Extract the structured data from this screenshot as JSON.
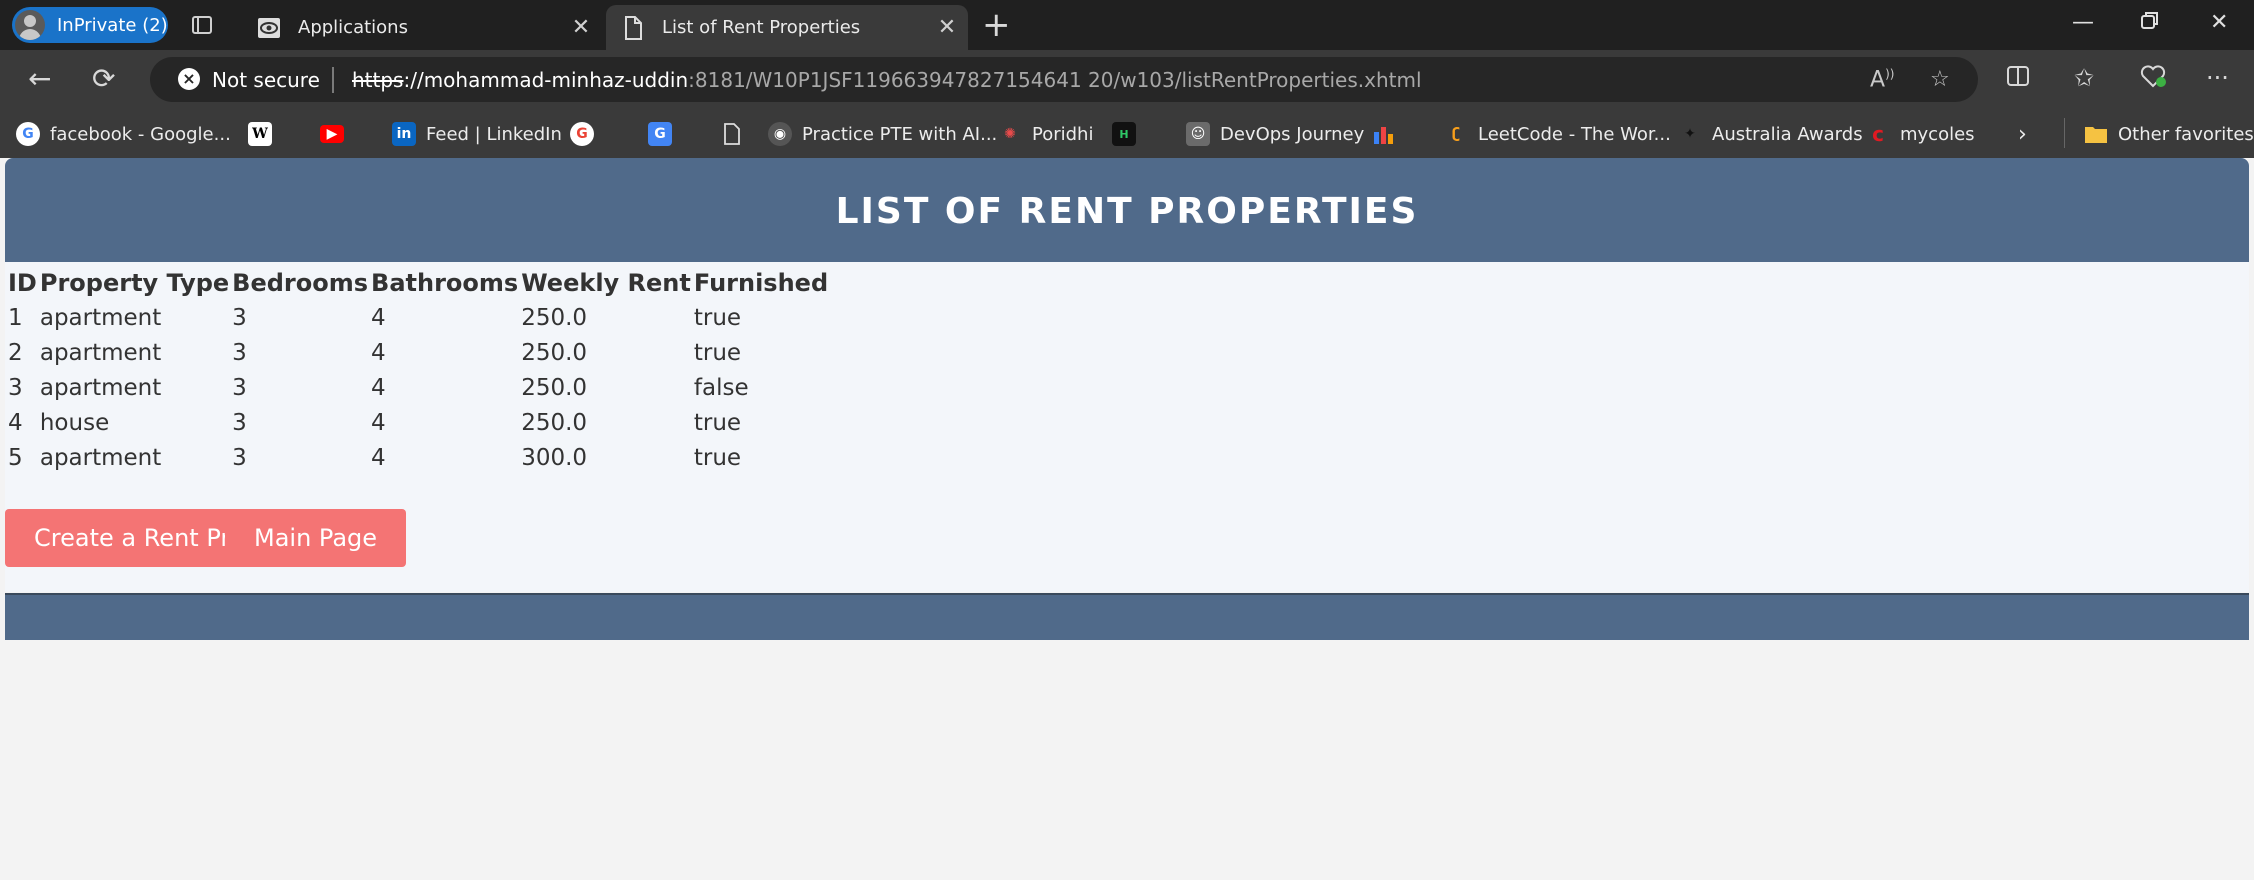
{
  "browser": {
    "profile_label": "InPrivate (2)",
    "tabs": [
      {
        "title": "Applications",
        "active": false
      },
      {
        "title": "List of Rent Properties",
        "active": true
      }
    ],
    "security_label": "Not secure",
    "url": {
      "scheme": "https",
      "sep": "://",
      "host": "mohammad-minhaz-uddin",
      "rest": ":8181/W10P1JSF119663947827154641 20/w103/listRentProperties.xhtml"
    },
    "bookmarks": [
      {
        "label": "facebook - Google...",
        "icon": "google-icon"
      },
      {
        "label": "",
        "icon": "wikipedia-icon"
      },
      {
        "label": "",
        "icon": "youtube-icon"
      },
      {
        "label": "Feed | LinkedIn",
        "icon": "linkedin-icon"
      },
      {
        "label": "",
        "icon": "google-icon"
      },
      {
        "label": "",
        "icon": "translate-icon"
      },
      {
        "label": "",
        "icon": "page-icon"
      },
      {
        "label": "Practice PTE with AI...",
        "icon": "pte-icon"
      },
      {
        "label": "Poridhi",
        "icon": "poridhi-icon"
      },
      {
        "label": "",
        "icon": "hackerrank-icon"
      },
      {
        "label": "DevOps Journey",
        "icon": "devops-icon"
      },
      {
        "label": "",
        "icon": "chart-icon"
      },
      {
        "label": "LeetCode - The Wor...",
        "icon": "leetcode-icon"
      },
      {
        "label": "Australia Awards",
        "icon": "australia-icon"
      },
      {
        "label": "mycoles",
        "icon": "coles-icon"
      }
    ],
    "other_favorites": "Other favorites"
  },
  "page": {
    "title": "LIST OF RENT PROPERTIES",
    "columns": [
      "ID",
      "Property Type",
      "Bedrooms",
      "Bathrooms",
      "Weekly Rent",
      "Furnished"
    ],
    "rows": [
      [
        "1",
        "apartment",
        "3",
        "4",
        "250.0",
        "true"
      ],
      [
        "2",
        "apartment",
        "3",
        "4",
        "250.0",
        "true"
      ],
      [
        "3",
        "apartment",
        "3",
        "4",
        "250.0",
        "false"
      ],
      [
        "4",
        "house",
        "3",
        "4",
        "250.0",
        "true"
      ],
      [
        "5",
        "apartment",
        "3",
        "4",
        "300.0",
        "true"
      ]
    ],
    "buttons": {
      "create": "Create a Rent Property",
      "main": "Main Page"
    }
  },
  "colors": {
    "header": "#506a8a",
    "button": "#f47474",
    "content_bg": "#f3f6fa"
  }
}
